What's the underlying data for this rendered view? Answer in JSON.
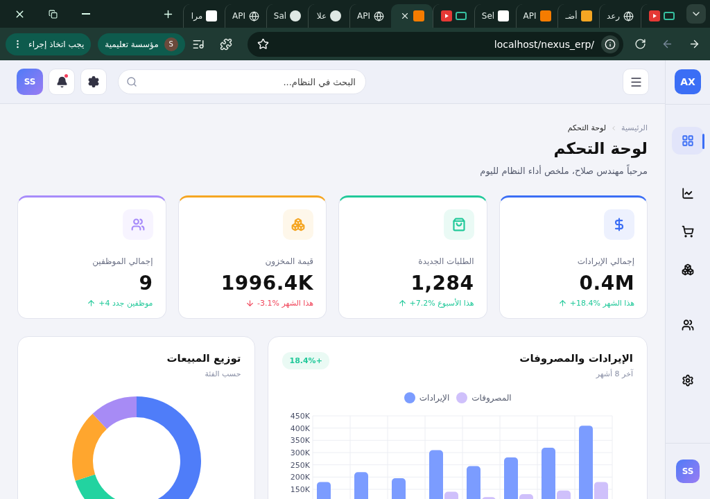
{
  "browser": {
    "tabs": [
      {
        "selected": false
      },
      {
        "title": "رعد",
        "selected": false
      },
      {
        "title": "أضـ",
        "selected": false
      },
      {
        "title": "API",
        "selected": false
      },
      {
        "title": "Sel",
        "selected": false
      },
      {
        "selected": false
      },
      {
        "selected": true
      },
      {
        "title": "API",
        "selected": false
      },
      {
        "title": "علا",
        "selected": false
      },
      {
        "title": "Sal",
        "selected": false
      },
      {
        "title": "API",
        "selected": false
      },
      {
        "title": "مرا",
        "selected": false
      }
    ],
    "url": "localhost/nexus_erp/",
    "profile": {
      "initial": "S",
      "name": "مؤسسة تعليمية"
    },
    "action_button": "يجب اتخاذ إجراء"
  },
  "sidebar": {
    "logo": "AX",
    "items": [
      {
        "selected": true
      },
      {
        "selected": false
      },
      {
        "selected": false
      },
      {
        "selected": false
      },
      {
        "selected": false
      },
      {
        "selected": false
      }
    ],
    "avatar": "SS"
  },
  "header": {
    "search": {
      "placeholder": "البحث في النظام..."
    },
    "notifications_unread": true,
    "avatar": "SS"
  },
  "breadcrumb": [
    "الرئيسية",
    "لوحة التحكم"
  ],
  "page_title": "لوحة التحكم",
  "page_subtitle": "مرحباً مهندس صلاح، ملخص أداء النظام لليوم",
  "stats": [
    {
      "title": "إجمالي الإيرادات",
      "value": "0.4M",
      "trend": "+18.4% هذا الشهر",
      "trend_up": true,
      "color": "#3b6ef5"
    },
    {
      "title": "الطلبات الجديدة",
      "value": "1,284",
      "trend": "+7.2% هذا الأسبوع",
      "trend_up": true,
      "color": "#22c99a"
    },
    {
      "title": "قيمة المخزون",
      "value": "1996.4K",
      "trend": "-3.1% هذا الشهر",
      "trend_up": false,
      "color": "#f5a623"
    },
    {
      "title": "إجمالي الموظفين",
      "value": "9",
      "trend": "+4 موظفين جدد",
      "trend_up": true,
      "color": "#a78bfa"
    }
  ],
  "revenue_chart": {
    "title": "الإيرادات والمصروفات",
    "subtitle": "آخر 8 أشهر",
    "badge": "+18.4%",
    "chart_data": {
      "type": "bar",
      "grid": true,
      "ylim": [
        0,
        450000
      ],
      "yticks": [
        {
          "value": 150000,
          "label": "150K"
        },
        {
          "value": 200000,
          "label": "200K"
        },
        {
          "value": 250000,
          "label": "250K"
        },
        {
          "value": 300000,
          "label": "300K"
        },
        {
          "value": 350000,
          "label": "350K"
        },
        {
          "value": 400000,
          "label": "400K"
        },
        {
          "value": 450000,
          "label": "450K"
        }
      ],
      "series": [
        {
          "name": "الإيرادات",
          "color": "#7b9cff",
          "values": [
            180000,
            220000,
            195000,
            310000,
            245000,
            280000,
            320000,
            410000
          ]
        },
        {
          "name": "المصروفات",
          "color": "#cfc0fb",
          "values": [
            null,
            null,
            null,
            140000,
            118000,
            130000,
            145000,
            180000
          ]
        }
      ]
    }
  },
  "sales_chart": {
    "title": "توزيع المبيعات",
    "subtitle": "حسب الفئة"
  }
}
